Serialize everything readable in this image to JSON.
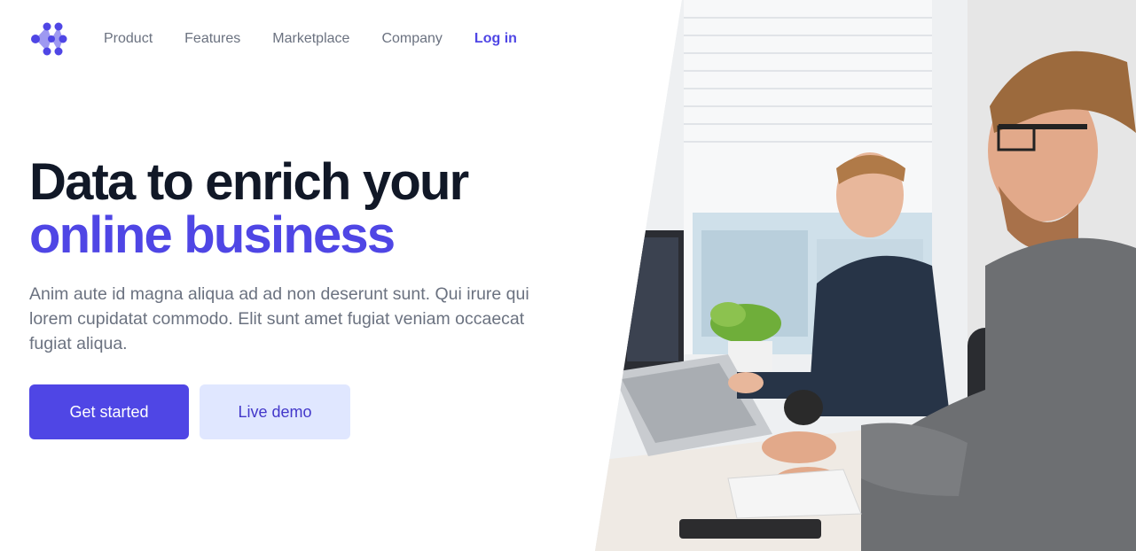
{
  "brand": {
    "logo_icon": "connected-dots-logo-icon",
    "accent": "#4f46e5"
  },
  "nav": {
    "links": [
      {
        "label": "Product"
      },
      {
        "label": "Features"
      },
      {
        "label": "Marketplace"
      },
      {
        "label": "Company"
      }
    ],
    "login": "Log in"
  },
  "hero": {
    "headline_line1": "Data to enrich your",
    "headline_line2": "online business",
    "lead": "Anim aute id magna aliqua ad ad non deserunt sunt. Qui irure qui lorem cupidatat commodo. Elit sunt amet fugiat veniam occaecat fugiat aliqua.",
    "primary_cta": "Get started",
    "secondary_cta": "Live demo"
  },
  "image": {
    "subject": "office-workers-photo"
  },
  "colors": {
    "heading": "#111827",
    "text": "#6b7280",
    "primary": "#4f46e5",
    "secondary_bg": "#e0e7ff"
  }
}
